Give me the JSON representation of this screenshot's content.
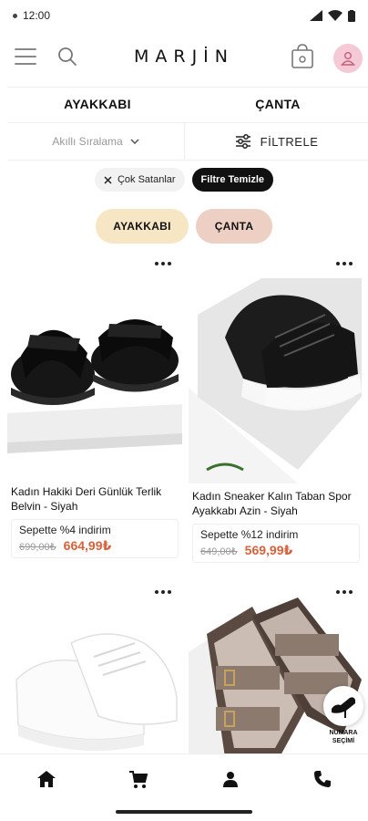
{
  "status_bar": {
    "time": "12:00"
  },
  "header": {
    "brand": "MARJİN"
  },
  "categories": [
    {
      "label": "AYAKKABI"
    },
    {
      "label": "ÇANTA"
    }
  ],
  "sort": {
    "selected": "Akıllı Sıralama"
  },
  "filter": {
    "label": "FİLTRELE"
  },
  "chips": {
    "active_filter": "Çok Satanlar",
    "clear_label": "Filtre Temizle"
  },
  "quick_pills": [
    {
      "label": "AYAKKABI",
      "color": "#f7e6c4"
    },
    {
      "label": "ÇANTA",
      "color": "#eecfc4"
    }
  ],
  "products": [
    {
      "title": "Kadın Hakiki Deri Günlük Terlik Belvin - Siyah",
      "discount_text": "Sepette %4 indirim",
      "old_price": "699,00₺",
      "new_price": "664,99₺"
    },
    {
      "title": "Kadın Sneaker Kalın Taban Spor Ayakkabı Azin - Siyah",
      "discount_text": "Sepette %12 indirim",
      "old_price": "649,00₺",
      "new_price": "569,99₺"
    },
    {
      "title": ""
    },
    {
      "title": ""
    }
  ],
  "numara_fab": {
    "label_line1": "NUMARA",
    "label_line2": "SEÇİMİ"
  },
  "bottom_nav": [
    {
      "icon": "home-icon"
    },
    {
      "icon": "cart-icon"
    },
    {
      "icon": "user-icon"
    },
    {
      "icon": "phone-icon"
    }
  ],
  "colors": {
    "price_accent": "#d7613b",
    "avatar_bg": "#f5c9d6"
  }
}
